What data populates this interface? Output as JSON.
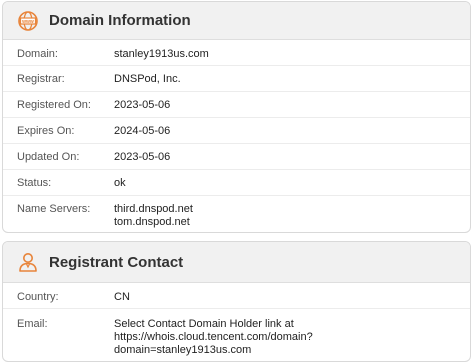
{
  "domain_info": {
    "title": "Domain Information",
    "icon": "globe-icon",
    "rows": [
      {
        "label": "Domain:",
        "value": "stanley1913us.com"
      },
      {
        "label": "Registrar:",
        "value": "DNSPod, Inc."
      },
      {
        "label": "Registered On:",
        "value": "2023-05-06"
      },
      {
        "label": "Expires On:",
        "value": "2024-05-06"
      },
      {
        "label": "Updated On:",
        "value": "2023-05-06"
      },
      {
        "label": "Status:",
        "value": "ok"
      },
      {
        "label": "Name Servers:",
        "values": [
          "third.dnspod.net",
          "tom.dnspod.net"
        ]
      }
    ]
  },
  "registrant": {
    "title": "Registrant Contact",
    "icon": "user-icon",
    "rows": [
      {
        "label": "Country:",
        "value": "CN"
      },
      {
        "label": "Email:",
        "values": [
          "Select Contact Domain Holder link at",
          "https://whois.cloud.tencent.com/domain?",
          "domain=stanley1913us.com"
        ]
      }
    ]
  },
  "colors": {
    "accent": "#e8843a",
    "header_bg": "#f1f1f1",
    "border": "#d9d9d9"
  }
}
